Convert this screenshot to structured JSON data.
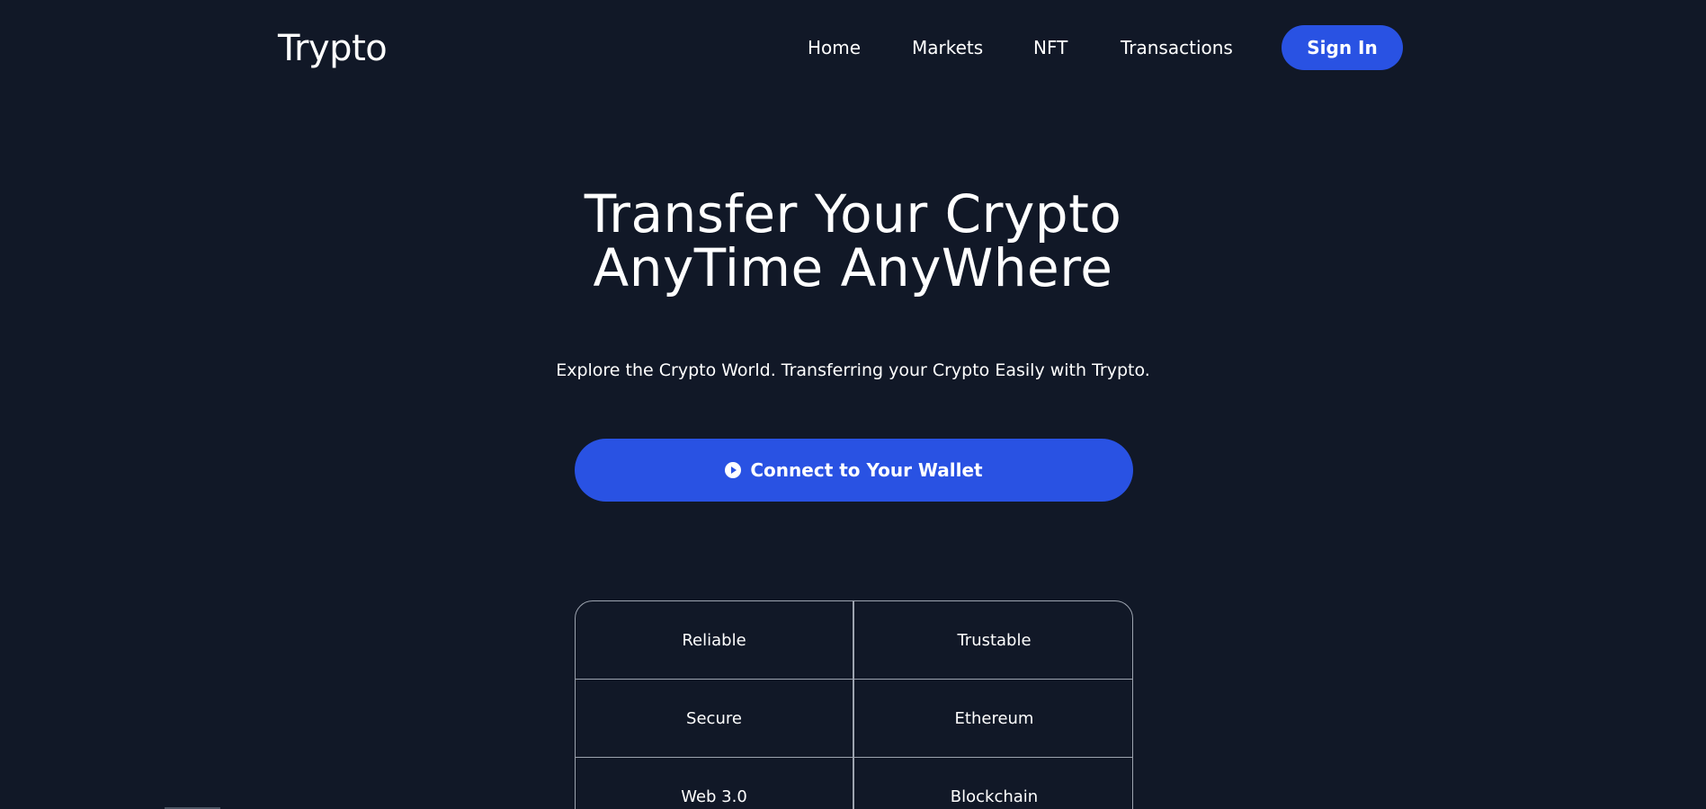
{
  "nav": {
    "logo": "Trypto",
    "links": [
      "Home",
      "Markets",
      "NFT",
      "Transactions"
    ],
    "signin_label": "Sign In"
  },
  "hero": {
    "title_line1": "Transfer Your Crypto",
    "title_line2": "AnyTime AnyWhere",
    "subtitle": "Explore the Crypto World. Transferring your Crypto Easily with Trypto.",
    "connect_label": "Connect to Your Wallet",
    "connect_icon": "play-circle-icon"
  },
  "features": [
    "Reliable",
    "Trustable",
    "Secure",
    "Ethereum",
    "Web 3.0",
    "Blockchain"
  ],
  "colors": {
    "background": "#111827",
    "accent": "#2952e3",
    "border": "#9ca3af"
  }
}
